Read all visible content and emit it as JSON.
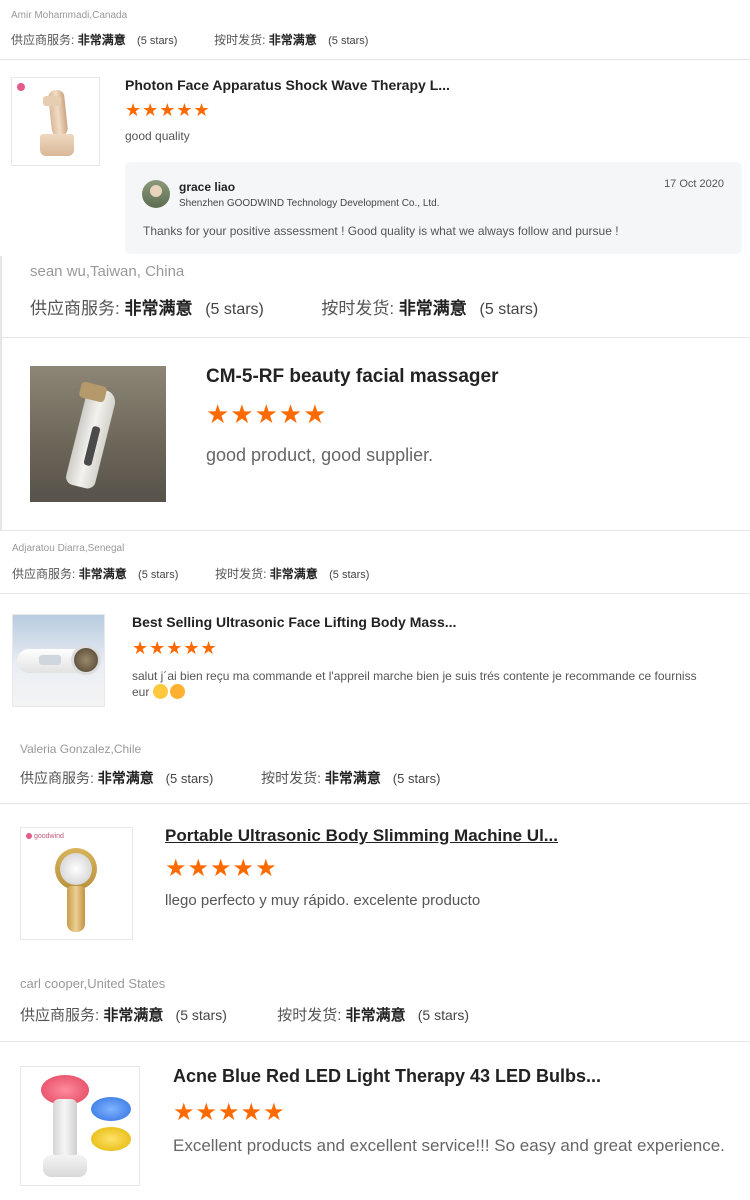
{
  "reviews": [
    {
      "reviewer": "Amir Mohammadi,Canada",
      "supplier_service_label": "供应商服务:",
      "supplier_service_value": "非常满意",
      "supplier_service_stars": "(5 stars)",
      "on_time_label": "按时发货:",
      "on_time_value": "非常满意",
      "on_time_stars": "(5 stars)",
      "product_title": "Photon Face Apparatus Shock Wave Therapy L...",
      "rating_glyphs": "★★★★★",
      "rating_value": 5,
      "comment": "good quality",
      "reply": {
        "name": "grace liao",
        "company": "Shenzhen GOODWIND Technology Development Co., Ltd.",
        "date": "17 Oct 2020",
        "text": "Thanks for your positive assessment ! Good quality is what we always follow and pursue !"
      }
    },
    {
      "reviewer": "sean wu,Taiwan, China",
      "supplier_service_label": "供应商服务:",
      "supplier_service_value": "非常满意",
      "supplier_service_stars": "(5 stars)",
      "on_time_label": "按时发货:",
      "on_time_value": "非常满意",
      "on_time_stars": "(5 stars)",
      "product_title": "CM-5-RF beauty facial massager",
      "rating_glyphs": "★★★★★",
      "rating_value": 5,
      "comment": "good product, good supplier."
    },
    {
      "reviewer": "Adjaratou Diarra,Senegal",
      "supplier_service_label": "供应商服务:",
      "supplier_service_value": "非常满意",
      "supplier_service_stars": "(5 stars)",
      "on_time_label": "按时发货:",
      "on_time_value": "非常满意",
      "on_time_stars": "(5 stars)",
      "product_title": "Best Selling Ultrasonic Face Lifting Body Mass...",
      "rating_glyphs": "★★★★★",
      "rating_value": 5,
      "comment_line1": "salut j´ai bien reçu ma commande et l'appreil marche bien je suis trés contente je recommande ce fourniss",
      "comment_line2": "eur"
    },
    {
      "reviewer": "Valeria Gonzalez,Chile",
      "supplier_service_label": "供应商服务:",
      "supplier_service_value": "非常满意",
      "supplier_service_stars": "(5 stars)",
      "on_time_label": "按时发货:",
      "on_time_value": "非常满意",
      "on_time_stars": "(5 stars)",
      "product_title": "Portable Ultrasonic Body Slimming Machine Ul...",
      "rating_glyphs": "★★★★★",
      "rating_value": 5,
      "comment": "llego perfecto y muy rápido. excelente producto"
    },
    {
      "reviewer": "carl cooper,United States",
      "supplier_service_label": "供应商服务:",
      "supplier_service_value": "非常满意",
      "supplier_service_stars": "(5 stars)",
      "on_time_label": "按时发货:",
      "on_time_value": "非常满意",
      "on_time_stars": "(5 stars)",
      "product_title": "Acne Blue Red LED Light Therapy 43 LED Bulbs...",
      "rating_glyphs": "★★★★★",
      "rating_value": 5,
      "comment": "Excellent products and excellent service!!! So easy and great experience."
    }
  ],
  "logo_text": "goodwind",
  "colors": {
    "star": "#ff6a00",
    "reply_bg": "#f5f6f8"
  }
}
